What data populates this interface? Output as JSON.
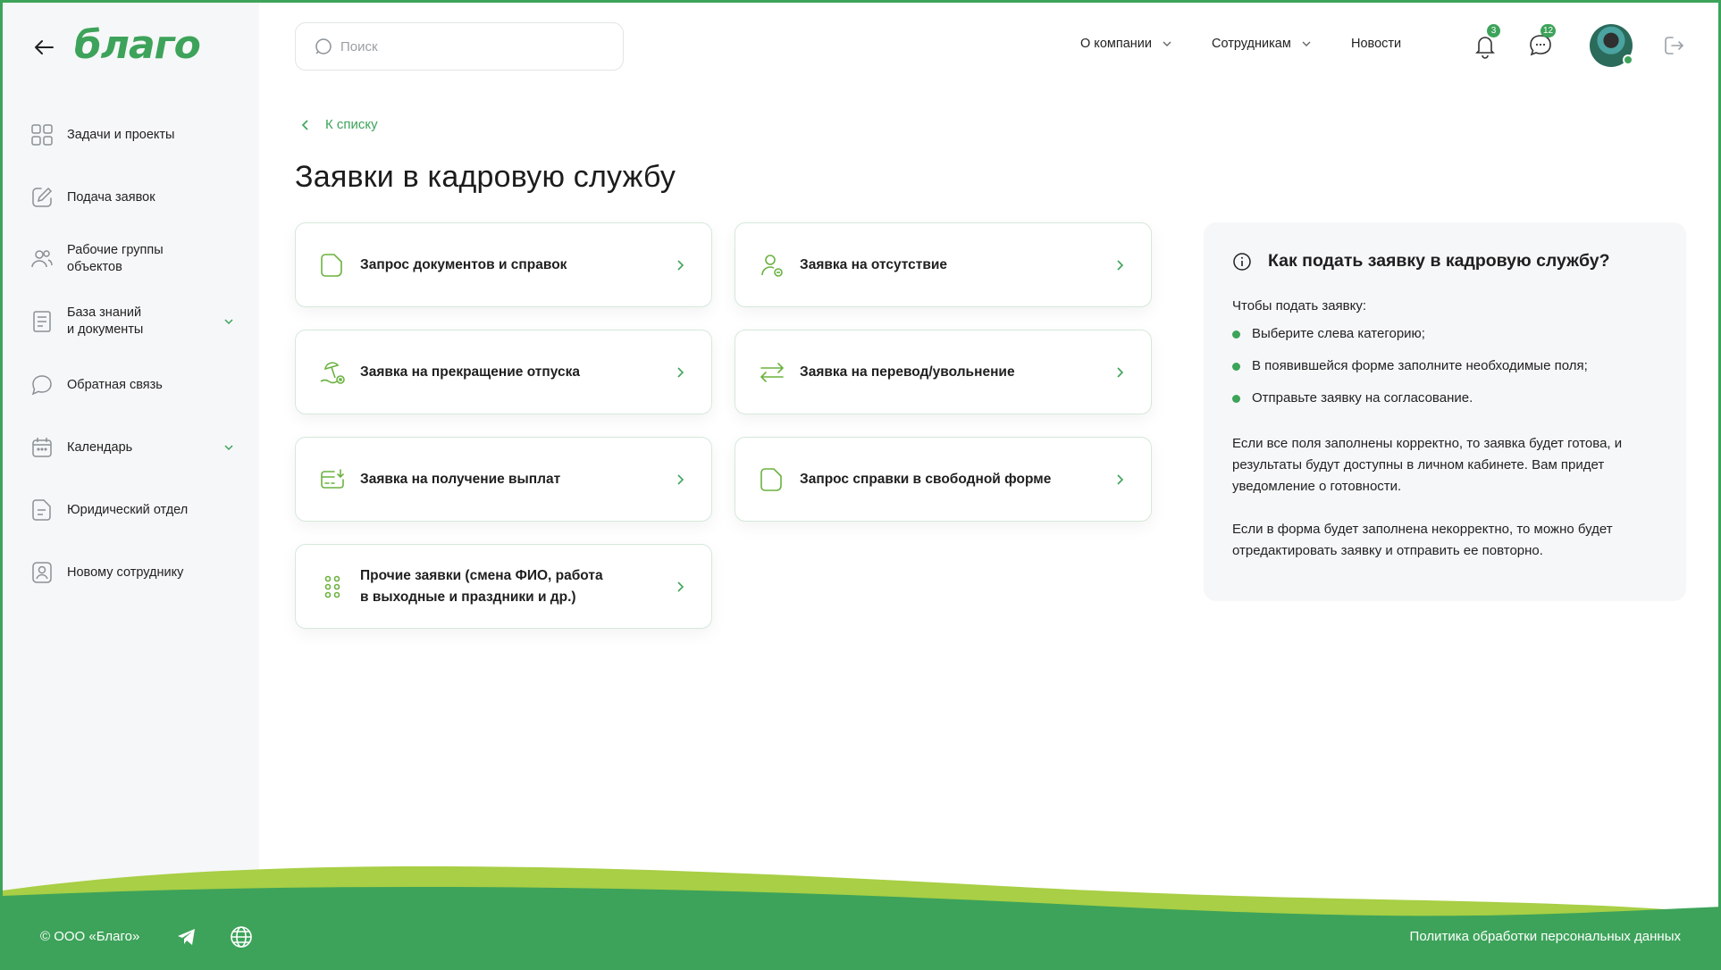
{
  "brand": {
    "logo_text": "благо",
    "accent": "#3da35a",
    "accent_light": "#a8cf45"
  },
  "sidebar": {
    "items": [
      {
        "label": "Задачи и проекты",
        "icon": "grid-icon"
      },
      {
        "label": "Подача заявок",
        "icon": "edit-icon"
      },
      {
        "label": "Рабочие группы\nобъектов",
        "icon": "users-icon"
      },
      {
        "label": "База знаний\nи документы",
        "icon": "book-icon",
        "expandable": true
      },
      {
        "label": "Обратная связь",
        "icon": "chat-icon"
      },
      {
        "label": "Календарь",
        "icon": "calendar-icon",
        "expandable": true
      },
      {
        "label": "Юридический отдел",
        "icon": "document-icon"
      },
      {
        "label": "Новому сотруднику",
        "icon": "user-badge-icon"
      }
    ]
  },
  "header": {
    "search_placeholder": "Поиск",
    "nav": [
      {
        "label": "О компании",
        "dropdown": true
      },
      {
        "label": "Сотрудникам",
        "dropdown": true
      },
      {
        "label": "Новости",
        "dropdown": false
      }
    ],
    "notifications_count": "3",
    "messages_count": "12"
  },
  "main": {
    "back_link": "К списку",
    "title": "Заявки в кадровую службу",
    "cards": [
      {
        "label": "Запрос документов и справок",
        "icon": "document-icon"
      },
      {
        "label": "Заявка на отсутствие",
        "icon": "user-minus-icon"
      },
      {
        "label": "Заявка на прекращение отпуска",
        "icon": "beach-cancel-icon"
      },
      {
        "label": "Заявка на перевод/увольнение",
        "icon": "transfer-arrows-icon"
      },
      {
        "label": "Заявка на получение выплат",
        "icon": "payment-icon"
      },
      {
        "label": "Запрос справки в свободной форме",
        "icon": "document-icon"
      },
      {
        "label": "Прочие заявки (смена ФИО, работа\nв выходные и праздники и др.)",
        "icon": "dots-grid-icon"
      }
    ]
  },
  "info": {
    "title": "Как подать заявку в кадровую службу?",
    "intro": "Чтобы подать заявку:",
    "steps": [
      "Выберите слева категорию;",
      "В появившейся форме заполните необходимые поля;",
      "Отправьте заявку на согласование."
    ],
    "paragraph1": "Если все поля заполнены корректно, то заявка будет готова, и результаты будут доступны в личном кабинете. Вам придет уведомление о готовности.",
    "paragraph2": "Если в форма будет заполнена некорректно, то можно будет отредактировать заявку и отправить ее повторно."
  },
  "footer": {
    "copyright": "© ООО «Благо»",
    "privacy": "Политика обработки персональных данных"
  }
}
